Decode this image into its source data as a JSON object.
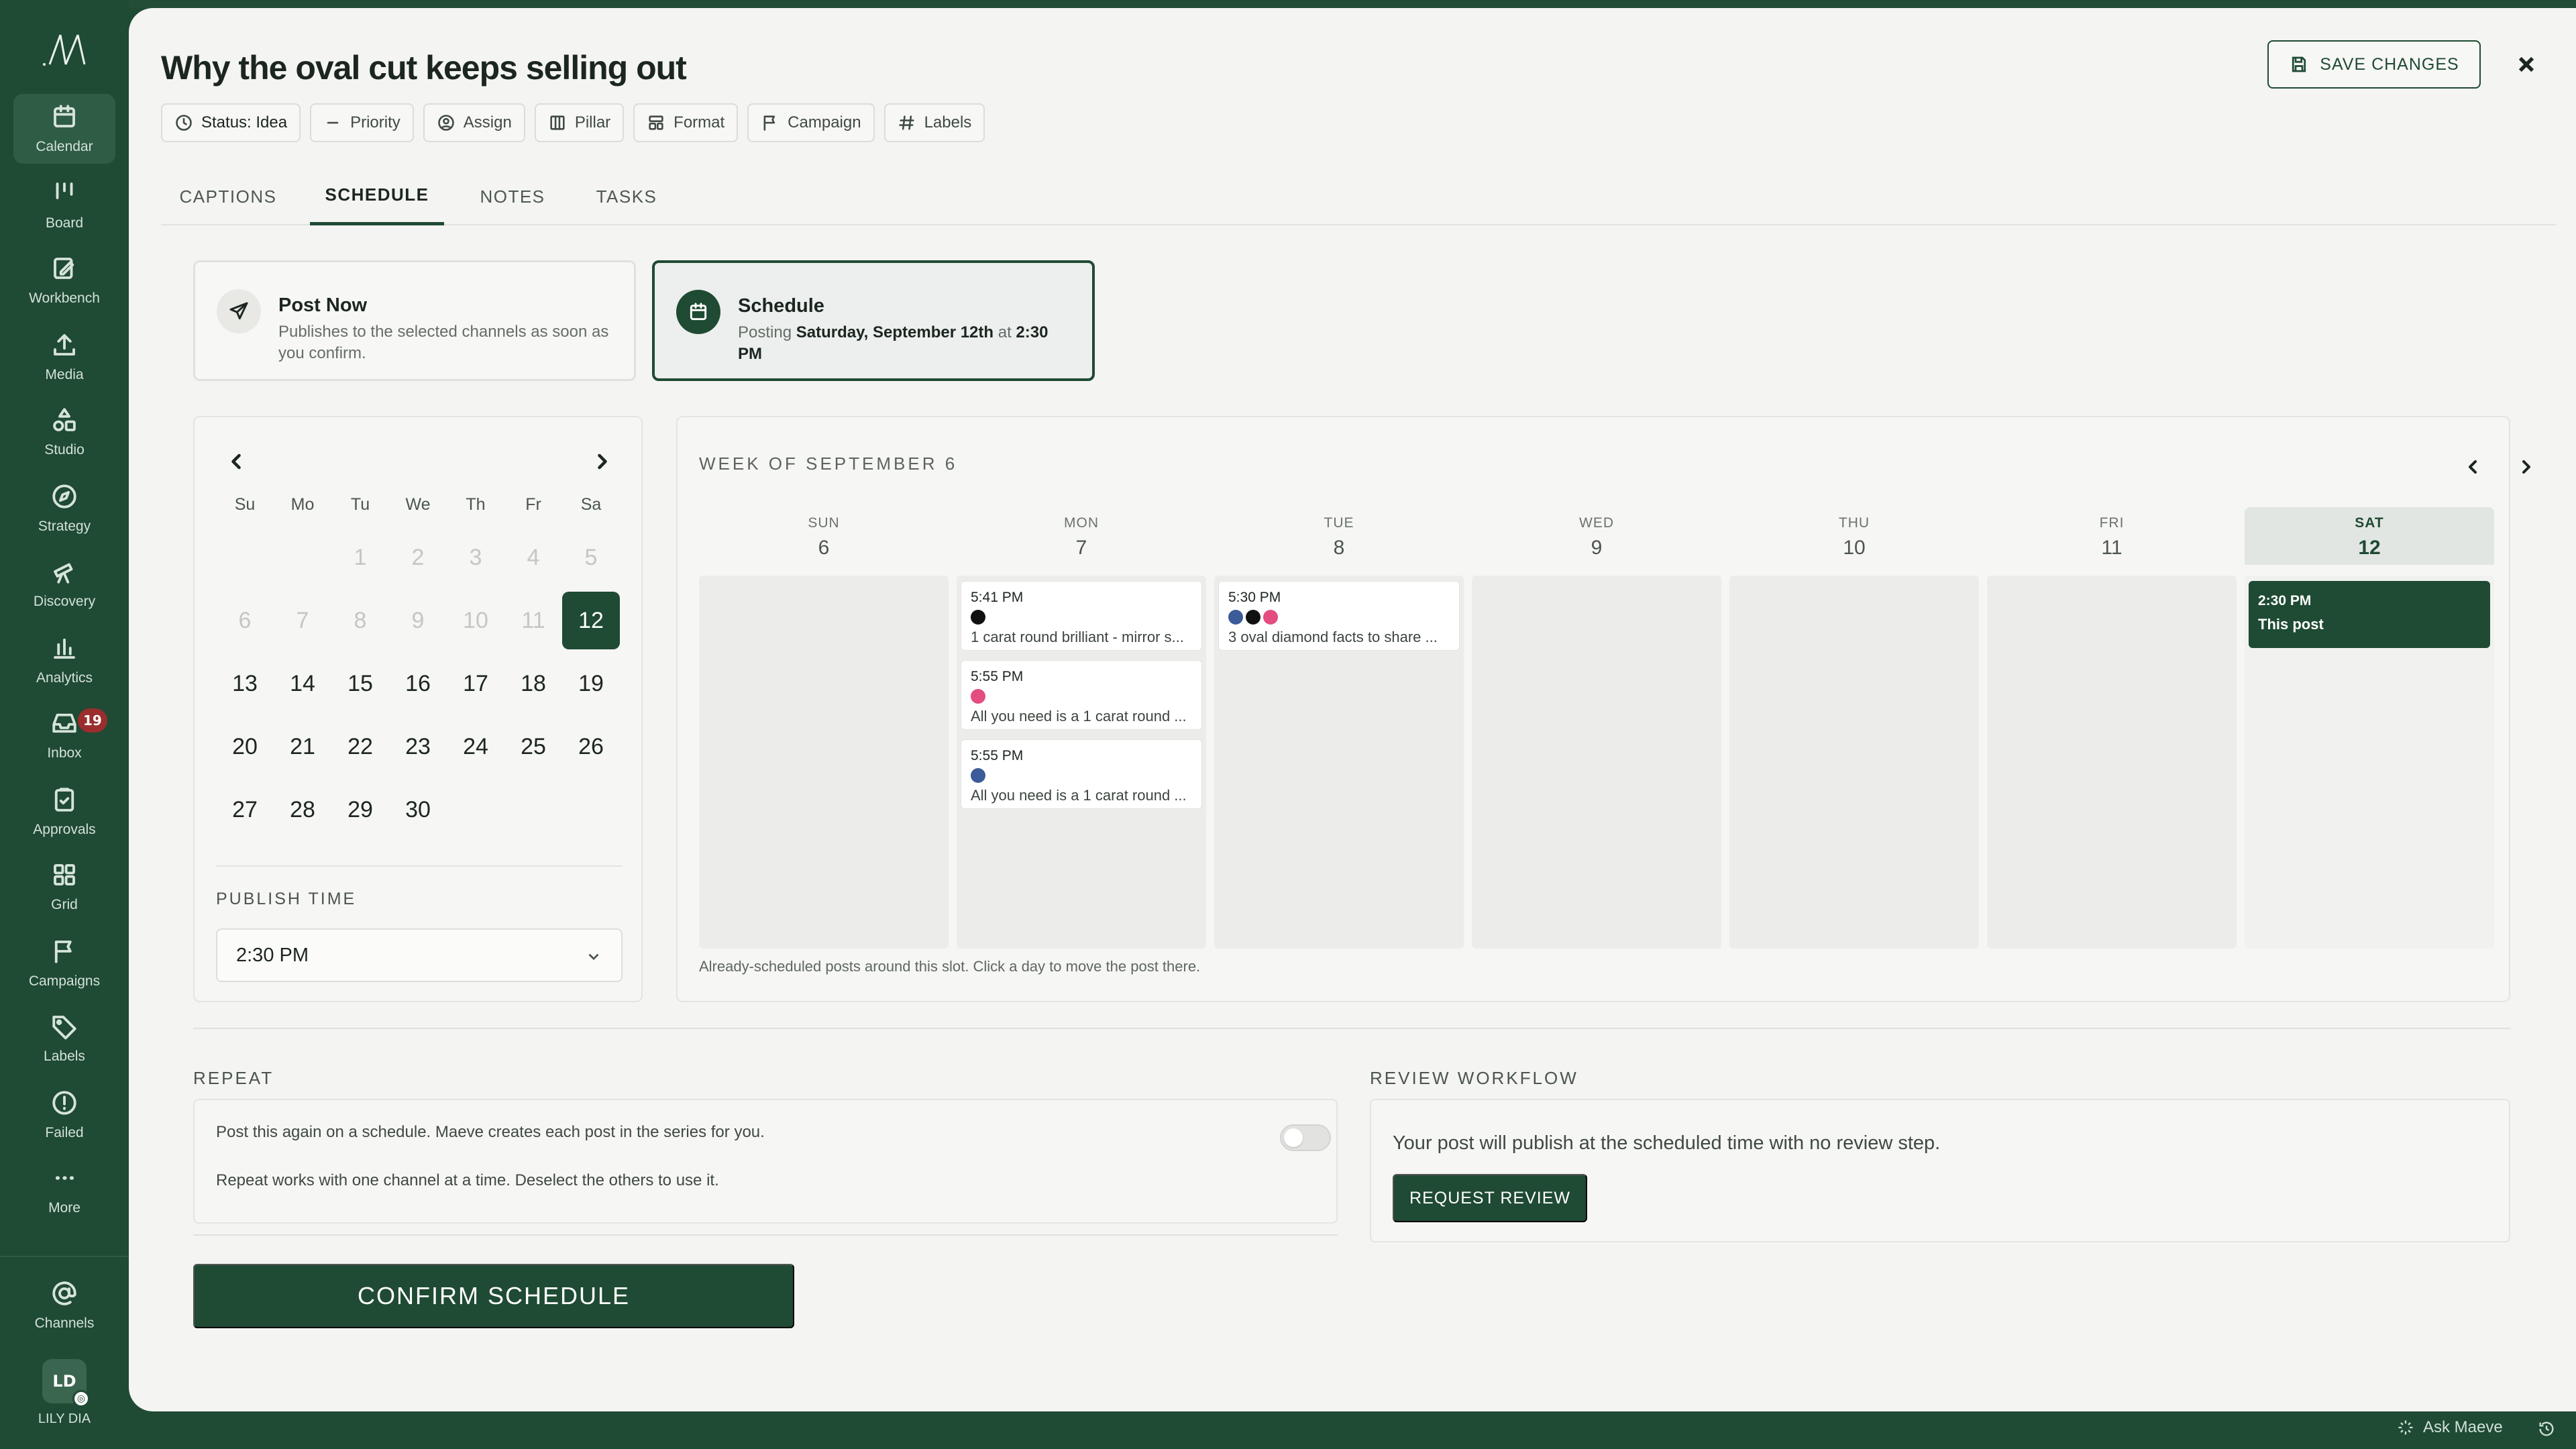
{
  "sidebar": {
    "items": [
      {
        "label": "Calendar",
        "icon": "calendar-icon",
        "active": true
      },
      {
        "label": "Board",
        "icon": "board-icon"
      },
      {
        "label": "Workbench",
        "icon": "edit-icon"
      },
      {
        "label": "Media",
        "icon": "upload-icon"
      },
      {
        "label": "Studio",
        "icon": "shapes-icon"
      },
      {
        "label": "Strategy",
        "icon": "compass-icon"
      },
      {
        "label": "Discovery",
        "icon": "telescope-icon"
      },
      {
        "label": "Analytics",
        "icon": "bar-chart-icon"
      },
      {
        "label": "Inbox",
        "icon": "inbox-icon",
        "badge": "19"
      },
      {
        "label": "Approvals",
        "icon": "clipboard-check-icon"
      },
      {
        "label": "Grid",
        "icon": "grid-icon"
      },
      {
        "label": "Campaigns",
        "icon": "flag-icon"
      },
      {
        "label": "Labels",
        "icon": "tag-icon"
      },
      {
        "label": "Failed",
        "icon": "alert-circle-icon"
      },
      {
        "label": "More",
        "icon": "ellipsis-icon"
      }
    ],
    "channels_label": "Channels",
    "user_initials": "LD",
    "user_name": "LILY DIA"
  },
  "header": {
    "title": "Why the oval cut keeps selling out",
    "save_label": "SAVE CHANGES",
    "chips": [
      "Status: Idea",
      "Priority",
      "Assign",
      "Pillar",
      "Format",
      "Campaign",
      "Labels"
    ]
  },
  "tabs": [
    "CAPTIONS",
    "SCHEDULE",
    "NOTES",
    "TASKS"
  ],
  "active_tab": "SCHEDULE",
  "modes": {
    "post_now": {
      "title": "Post Now",
      "desc": "Publishes to the selected channels as soon as you confirm."
    },
    "schedule": {
      "title": "Schedule",
      "prefix": "Posting",
      "date": "Saturday, September 12th",
      "at": "at",
      "time": "2:30 PM"
    }
  },
  "mini_calendar": {
    "dow": [
      "Su",
      "Mo",
      "Tu",
      "We",
      "Th",
      "Fr",
      "Sa"
    ],
    "days": [
      [
        "",
        "",
        "1",
        "2",
        "3",
        "4",
        "5"
      ],
      [
        "6",
        "7",
        "8",
        "9",
        "10",
        "11",
        "12"
      ],
      [
        "13",
        "14",
        "15",
        "16",
        "17",
        "18",
        "19"
      ],
      [
        "20",
        "21",
        "22",
        "23",
        "24",
        "25",
        "26"
      ],
      [
        "27",
        "28",
        "29",
        "30",
        "",
        "",
        ""
      ]
    ],
    "selected": "12",
    "publish_time_label": "PUBLISH TIME",
    "publish_time": "2:30 PM"
  },
  "week": {
    "title": "WEEK OF SEPTEMBER 6",
    "days": [
      {
        "dow": "SUN",
        "num": "6",
        "posts": []
      },
      {
        "dow": "MON",
        "num": "7",
        "posts": [
          {
            "time": "5:41 PM",
            "channels": [
              "tiktok"
            ],
            "text": "1 carat round brilliant - mirror s..."
          },
          {
            "time": "5:55 PM",
            "channels": [
              "instagram"
            ],
            "text": "All you need is a 1 carat round ..."
          },
          {
            "time": "5:55 PM",
            "channels": [
              "facebook"
            ],
            "text": "All you need is a 1 carat round ..."
          }
        ]
      },
      {
        "dow": "TUE",
        "num": "8",
        "posts": [
          {
            "time": "5:30 PM",
            "channels": [
              "facebook",
              "tiktok",
              "instagram"
            ],
            "text": "3 oval diamond facts to share ..."
          }
        ]
      },
      {
        "dow": "WED",
        "num": "9",
        "posts": []
      },
      {
        "dow": "THU",
        "num": "10",
        "posts": []
      },
      {
        "dow": "FRI",
        "num": "11",
        "posts": []
      },
      {
        "dow": "SAT",
        "num": "12",
        "today": true,
        "this_post": {
          "time": "2:30 PM",
          "label": "This post"
        }
      }
    ],
    "hint": "Already-scheduled posts around this slot. Click a day to move the post there."
  },
  "repeat": {
    "label": "REPEAT",
    "line1": "Post this again on a schedule. Maeve creates each post in the series for you.",
    "line2": "Repeat works with one channel at a time. Deselect the others to use it."
  },
  "review": {
    "label": "REVIEW WORKFLOW",
    "text": "Your post will publish at the scheduled time with no review step.",
    "button": "REQUEST REVIEW"
  },
  "confirm_label": "CONFIRM SCHEDULE",
  "footer": {
    "ask_label": "Ask Maeve"
  },
  "colors": {
    "brand": "#1f4a33",
    "badge": "#9b2d2d",
    "instagram": "#e34d7f",
    "facebook": "#3b5b99",
    "tiktok": "#111111"
  }
}
